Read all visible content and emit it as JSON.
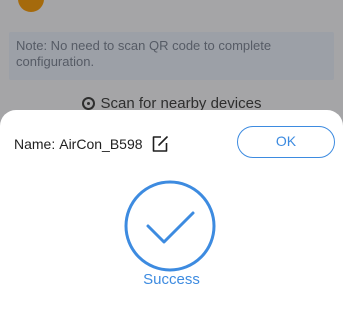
{
  "background": {
    "note": "Note: No need to scan QR code to complete configuration.",
    "scan_label": "Scan for nearby devices"
  },
  "dialog": {
    "name_label": "Name:",
    "device_name": "AirCon_B598",
    "ok_label": "OK",
    "status_text": "Success"
  },
  "colors": {
    "accent": "#3d8be0",
    "note_bg": "#e6ecf7"
  },
  "icons": {
    "edit": "edit-icon",
    "success": "checkmark-circle-icon",
    "scan": "scan-icon"
  }
}
